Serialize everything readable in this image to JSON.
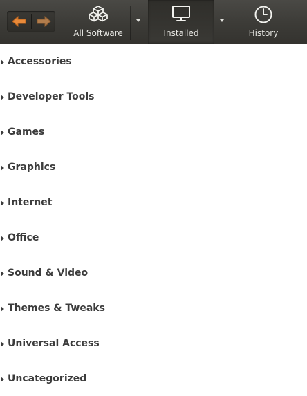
{
  "toolbar": {
    "all_software_label": "All Software",
    "installed_label": "Installed",
    "history_label": "History",
    "active_view": "Installed"
  },
  "colors": {
    "toolbar_bg": "#3c3b37",
    "arrow_orange": "#e98a3a",
    "text_light": "#e6e6e2",
    "category_text": "#3c3c3c"
  },
  "icons": {
    "back": "left-arrow-icon",
    "forward": "right-arrow-icon",
    "all_software": "boxes-icon",
    "installed": "monitor-icon",
    "history": "clock-icon"
  },
  "categories": [
    {
      "label": "Accessories"
    },
    {
      "label": "Developer Tools"
    },
    {
      "label": "Games"
    },
    {
      "label": "Graphics"
    },
    {
      "label": "Internet"
    },
    {
      "label": "Office"
    },
    {
      "label": "Sound & Video"
    },
    {
      "label": "Themes & Tweaks"
    },
    {
      "label": "Universal Access"
    },
    {
      "label": "Uncategorized"
    }
  ]
}
